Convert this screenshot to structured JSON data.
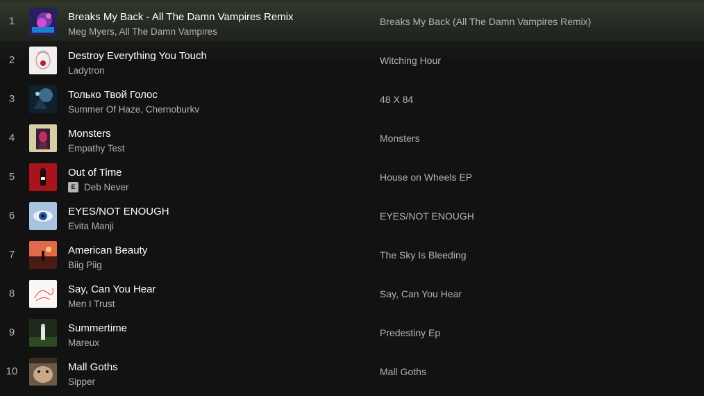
{
  "tracks": [
    {
      "num": "1",
      "title": "Breaks My Back - All The Damn Vampires Remix",
      "artists": "Meg Myers, All The Damn Vampires",
      "album": "Breaks My Back (All The Damn Vampires Remix)",
      "explicit": false
    },
    {
      "num": "2",
      "title": "Destroy Everything You Touch",
      "artists": "Ladytron",
      "album": "Witching Hour",
      "explicit": false
    },
    {
      "num": "3",
      "title": "Только Твой Голос",
      "artists": "Summer Of Haze, Chernoburkv",
      "album": "48 X 84",
      "explicit": false
    },
    {
      "num": "4",
      "title": "Monsters",
      "artists": "Empathy Test",
      "album": "Monsters",
      "explicit": false
    },
    {
      "num": "5",
      "title": "Out of Time",
      "artists": "Deb Never",
      "album": "House on Wheels EP",
      "explicit": true,
      "explicit_label": "E"
    },
    {
      "num": "6",
      "title": "EYES/NOT ENOUGH",
      "artists": "Evita Manji",
      "album": "EYES/NOT ENOUGH",
      "explicit": false
    },
    {
      "num": "7",
      "title": "American Beauty",
      "artists": "Biig Piig",
      "album": "The Sky Is Bleeding",
      "explicit": false
    },
    {
      "num": "8",
      "title": "Say, Can You Hear",
      "artists": "Men I Trust",
      "album": "Say, Can You Hear",
      "explicit": false
    },
    {
      "num": "9",
      "title": "Summertime",
      "artists": "Mareux",
      "album": "Predestiny Ep",
      "explicit": false
    },
    {
      "num": "10",
      "title": "Mall Goths",
      "artists": "Sipper",
      "album": "Mall Goths",
      "explicit": false
    }
  ],
  "colors": {
    "background": "#121212",
    "text_primary": "#ffffff",
    "text_secondary": "#b3b3b3"
  }
}
